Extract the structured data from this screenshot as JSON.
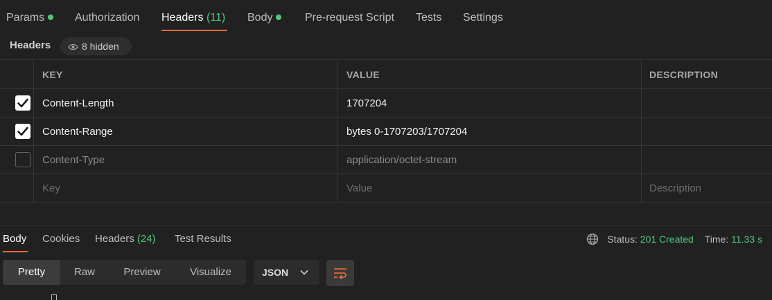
{
  "request_tabs": [
    {
      "label": "Params",
      "dot": true
    },
    {
      "label": "Authorization"
    },
    {
      "label": "Headers",
      "count": "(11)",
      "active": true
    },
    {
      "label": "Body",
      "dot": true
    },
    {
      "label": "Pre-request Script"
    },
    {
      "label": "Tests"
    },
    {
      "label": "Settings"
    }
  ],
  "headers_section": {
    "title": "Headers",
    "hidden_label": "8 hidden",
    "columns": {
      "key": "KEY",
      "value": "VALUE",
      "description": "DESCRIPTION"
    },
    "rows": [
      {
        "checked": true,
        "key": "Content-Length",
        "value": "1707204",
        "description": ""
      },
      {
        "checked": true,
        "key": "Content-Range",
        "value": "bytes 0-1707203/1707204",
        "description": ""
      },
      {
        "checked": false,
        "key": "Content-Type",
        "value": "application/octet-stream",
        "description": ""
      }
    ],
    "new_row": {
      "key_placeholder": "Key",
      "value_placeholder": "Value",
      "description_placeholder": "Description"
    }
  },
  "response_tabs": [
    {
      "label": "Body",
      "active": true
    },
    {
      "label": "Cookies"
    },
    {
      "label": "Headers",
      "count": "(24)"
    },
    {
      "label": "Test Results"
    }
  ],
  "status": {
    "label": "Status:",
    "value": "201 Created",
    "time_label": "Time:",
    "time_value": "11.33 s"
  },
  "view_modes": [
    "Pretty",
    "Raw",
    "Preview",
    "Visualize"
  ],
  "active_view": "Pretty",
  "format": "JSON",
  "colors": {
    "accent": "#ff6c37",
    "success": "#50c878",
    "background": "#212121"
  },
  "icons": {
    "hidden": "eye-icon",
    "network": "globe-icon",
    "format": "chevron-down-icon",
    "wrap": "wrap-lines-icon",
    "checkbox": "check-icon"
  }
}
